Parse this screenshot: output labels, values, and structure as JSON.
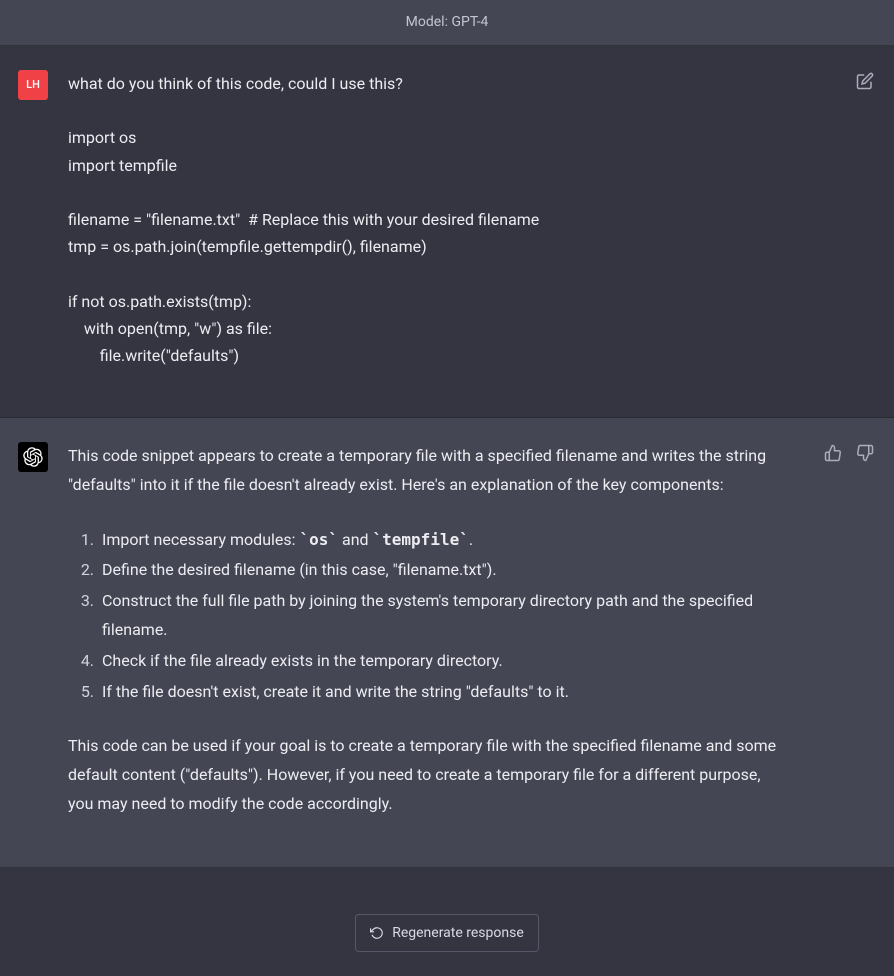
{
  "header": {
    "model_label": "Model: GPT-4"
  },
  "user": {
    "avatar_initials": "LH",
    "message": "what do you think of this code, could I use this?\n\nimport os\nimport tempfile\n\nfilename = \"filename.txt\"  # Replace this with your desired filename\ntmp = os.path.join(tempfile.gettempdir(), filename)\n\nif not os.path.exists(tmp):\n    with open(tmp, \"w\") as file:\n        file.write(\"defaults\")"
  },
  "assistant": {
    "intro": "This code snippet appears to create a temporary file with a specified filename and writes the string \"defaults\" into it if the file doesn't already exist. Here's an explanation of the key components:",
    "items": {
      "0": {
        "pre": "Import necessary modules: ",
        "code1": "`os`",
        "mid": " and ",
        "code2": "`tempfile`",
        "post": "."
      },
      "1": {
        "text": "Define the desired filename (in this case, \"filename.txt\")."
      },
      "2": {
        "text": "Construct the full file path by joining the system's temporary directory path and the specified filename."
      },
      "3": {
        "text": "Check if the file already exists in the temporary directory."
      },
      "4": {
        "text": "If the file doesn't exist, create it and write the string \"defaults\" to it."
      }
    },
    "outro": "This code can be used if your goal is to create a temporary file with the specified filename and some default content (\"defaults\"). However, if you need to create a temporary file for a different purpose, you may need to modify the code accordingly."
  },
  "footer": {
    "regenerate_label": "Regenerate response"
  }
}
